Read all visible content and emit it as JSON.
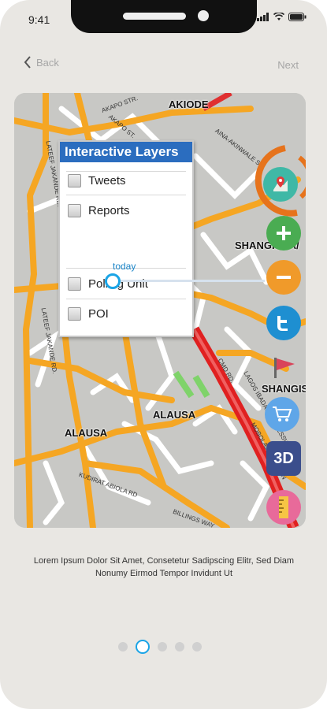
{
  "status_bar": {
    "time": "9:41"
  },
  "nav": {
    "back_label": "Back",
    "next_label": "Next"
  },
  "map": {
    "place_labels": [
      "AKIODE",
      "SHANGISHA/",
      "SHANGISH",
      "ALAUSA",
      "ALAUSA"
    ],
    "road_labels": [
      "AKAPO STR.",
      "AKAPO ST.",
      "LATEEF JAKANDE RD.",
      "LATEEF JAKANDE RD.",
      "KUDIRAT ABIOLA RD",
      "BILLINGS WAY",
      "MOBOLAJI JOHNSON",
      "LAGOS IBADAN EXPRESSWAY",
      "CMD RD.",
      "AINA-AKINWALE ST."
    ]
  },
  "layers_panel": {
    "title": "Interactive Layers",
    "layers": [
      "Tweets",
      "Reports",
      "Polling Unit",
      "POI"
    ],
    "time_slider_label": "today"
  },
  "toolbar": {
    "tools": [
      "location-pin",
      "zoom-in",
      "zoom-out",
      "twitter",
      "report-flag",
      "shopping-cart",
      "3d-view",
      "measure-ruler"
    ],
    "three_d_label": "3D"
  },
  "caption": "Lorem Ipsum Dolor Sit Amet, Consetetur Sadipscing Elitr, Sed Diam Nonumy Eirmod Tempor Invidunt Ut",
  "pagination": {
    "total": 5,
    "active": 2
  }
}
